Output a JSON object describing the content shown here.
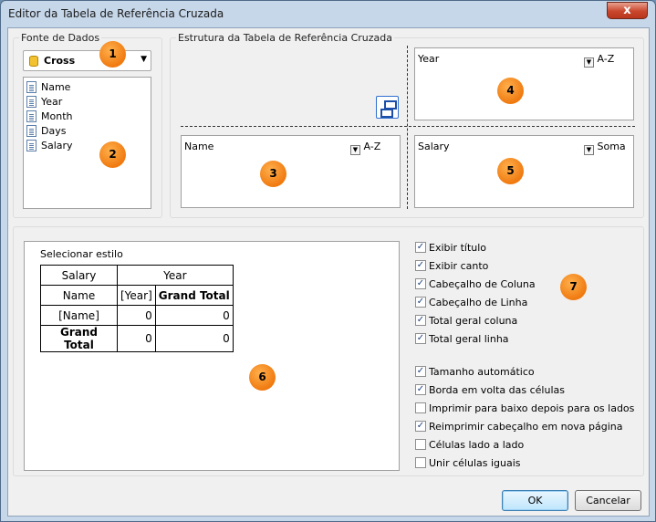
{
  "window": {
    "title": "Editor da Tabela de Referência Cruzada",
    "close_label": "x"
  },
  "data_source": {
    "group_label": "Fonte de Dados",
    "selected": "Cross",
    "fields": [
      "Name",
      "Year",
      "Month",
      "Days",
      "Salary"
    ]
  },
  "structure": {
    "group_label": "Estrutura da Tabela de Referência Cruzada",
    "columns_zone": {
      "field": "Year",
      "sort": "A-Z"
    },
    "rows_zone": {
      "field": "Name",
      "sort": "A-Z"
    },
    "summary_zone": {
      "field": "Salary",
      "function": "Soma"
    }
  },
  "badges": [
    "1",
    "2",
    "3",
    "4",
    "5",
    "6",
    "7"
  ],
  "preview": {
    "caption": "Selecionar estilo",
    "cells": {
      "summary_field": "Salary",
      "column_field": "Year",
      "row_field": "Name",
      "column_value": "[Year]",
      "column_total": "Grand Total",
      "row_value": "[Name]",
      "row_total": "Grand Total",
      "v11": "0",
      "v12": "0",
      "v21": "0",
      "v22": "0"
    }
  },
  "options": [
    {
      "label": "Exibir título",
      "checked": true
    },
    {
      "label": "Exibir canto",
      "checked": true
    },
    {
      "label": "Cabeçalho de Coluna",
      "checked": true
    },
    {
      "label": "Cabeçalho de Linha",
      "checked": true
    },
    {
      "label": "Total geral coluna",
      "checked": true
    },
    {
      "label": "Total geral linha",
      "checked": true
    },
    {
      "label": "Tamanho automático",
      "checked": true
    },
    {
      "label": "Borda em volta das células",
      "checked": true
    },
    {
      "label": "Imprimir para baixo depois para os lados",
      "checked": false
    },
    {
      "label": "Reimprimir cabeçalho em nova página",
      "checked": true
    },
    {
      "label": "Células lado a lado",
      "checked": false
    },
    {
      "label": "Unir células iguais",
      "checked": false
    }
  ],
  "buttons": {
    "ok": "OK",
    "cancel": "Cancelar"
  }
}
